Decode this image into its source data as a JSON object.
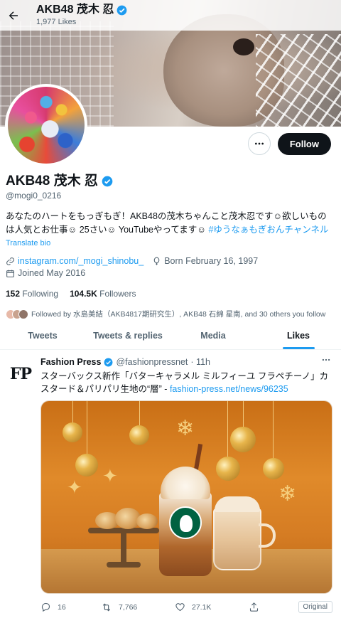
{
  "header": {
    "title": "AKB48 茂木 忍",
    "likes_count": "1,977 Likes"
  },
  "profile": {
    "name": "AKB48 茂木 忍",
    "handle": "@mogi0_0216",
    "bio_text": "あなたのハートをもっぎもぎ！AKB48の茂木ちゃんこと茂木忍です☺欲しいものは人気とお仕事☺ 25さい☺ YouTubeやってます☺ ",
    "bio_hashtag": "#ゆうなぁもぎおんチャンネル",
    "translate": "Translate bio",
    "website": "instagram.com/_mogi_shinobu_",
    "birthday": "Born February 16, 1997",
    "joined": "Joined May 2016",
    "following_count": "152",
    "following_label": "Following",
    "followers_count": "104.5K",
    "followers_label": "Followers",
    "followed_by": "Followed by 水島美結（AKB4817期研究生）, AKB48 石綿 星南, and 30 others you follow"
  },
  "actions": {
    "follow": "Follow"
  },
  "tabs": [
    {
      "label": "Tweets"
    },
    {
      "label": "Tweets & replies"
    },
    {
      "label": "Media"
    },
    {
      "label": "Likes",
      "active": true
    }
  ],
  "tweet": {
    "logo_text": "FP",
    "author_name": "Fashion Press",
    "author_handle": "@fashionpressnet",
    "time": "· 11h",
    "text": "スターバックス新作「バターキャラメル ミルフィーユ フラペチーノ」カスタード＆パリパリ生地の“層” - ",
    "link": "fashion-press.net/news/96235",
    "reply_count": "16",
    "retweet_count": "7,766",
    "like_count": "27.1K",
    "badge": "Original"
  },
  "colors": {
    "accent": "#1d9bf0",
    "text": "#0f1419",
    "secondary": "#536471",
    "follow_bg": "#0f1419"
  }
}
